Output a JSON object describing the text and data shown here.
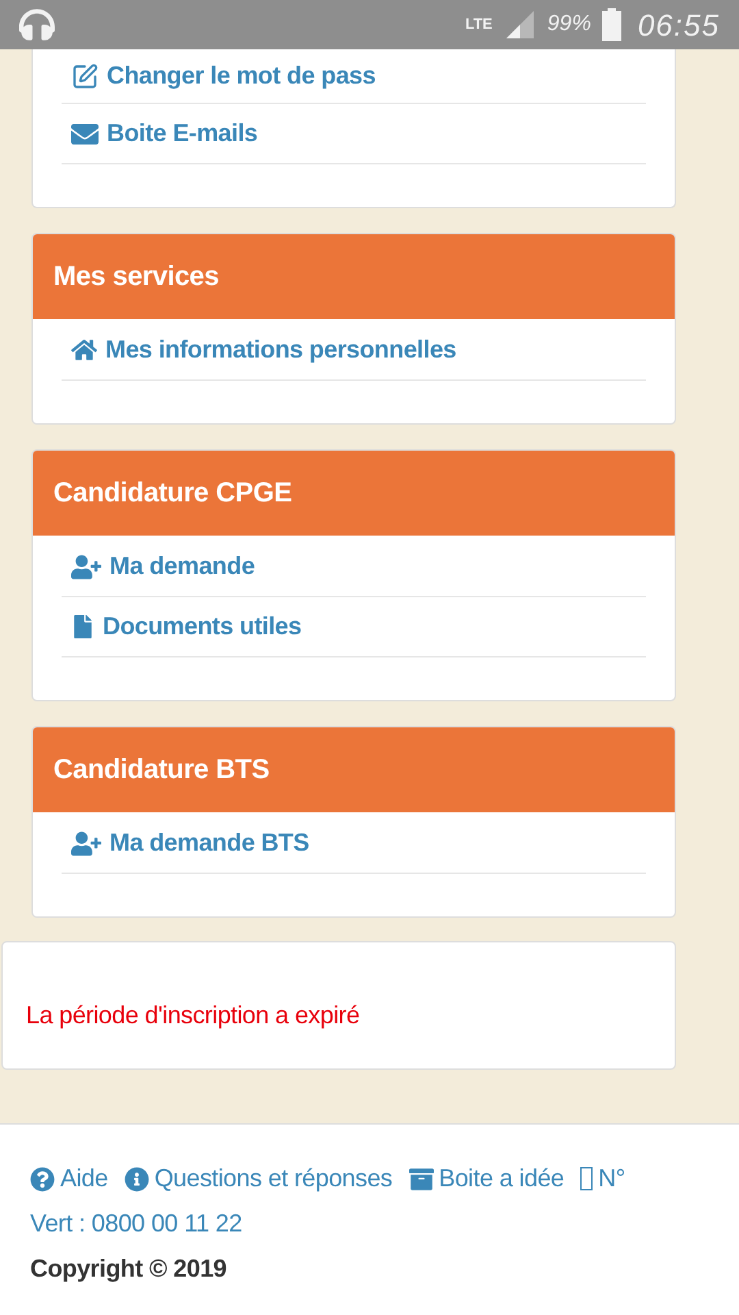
{
  "status_bar": {
    "network": "LTE",
    "battery": "99%",
    "time": "06:55"
  },
  "account_links": [
    {
      "label": "Changer le mot de pass",
      "kind": "edit"
    },
    {
      "label": "Boite E-mails",
      "kind": "mail"
    }
  ],
  "sections": [
    {
      "title": "Mes services",
      "items": [
        {
          "label": "Mes informations personnelles",
          "kind": "home"
        }
      ]
    },
    {
      "title": "Candidature CPGE",
      "items": [
        {
          "label": "Ma demande",
          "kind": "user-add"
        },
        {
          "label": "Documents utiles",
          "kind": "file"
        }
      ]
    },
    {
      "title": "Candidature BTS",
      "items": [
        {
          "label": "Ma demande BTS",
          "kind": "user-add"
        }
      ]
    }
  ],
  "notice": "La période d'inscription a expiré",
  "footer": {
    "links": [
      {
        "label": "Aide",
        "kind": "help"
      },
      {
        "label": "Questions et réponses",
        "kind": "info"
      },
      {
        "label": "Boite a idée",
        "kind": "archive"
      },
      {
        "label": "N°",
        "kind": "missing"
      }
    ],
    "phone": "Vert : 0800 00 11 22",
    "copyright": "Copyright © 2019"
  }
}
